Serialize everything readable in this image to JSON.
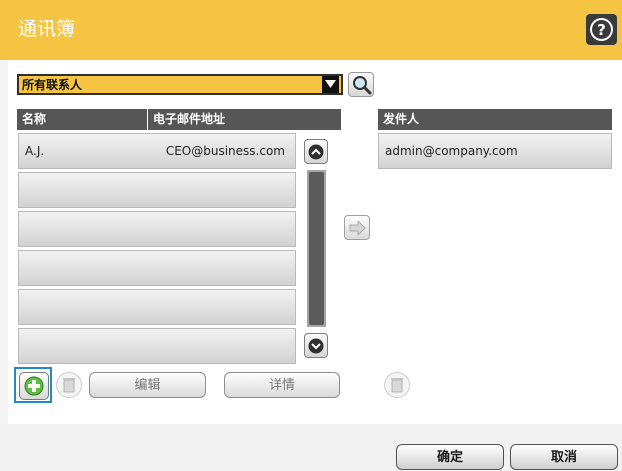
{
  "app": {
    "title": "通讯簿"
  },
  "icons": {
    "help": "help-icon",
    "search": "search-icon",
    "transfer": "arrow-right-icon",
    "add": "add-icon",
    "delete": "trash-icon",
    "scroll_up": "chevron-up-icon",
    "scroll_down": "chevron-down-icon",
    "dropdown": "dropdown-arrow-icon"
  },
  "colors": {
    "header": "#f6c443",
    "selected_outline": "#1e8ac9"
  },
  "filter": {
    "selected": "所有联系人"
  },
  "contacts": {
    "columns": {
      "name": "名称",
      "email": "电子邮件地址"
    },
    "rows": [
      {
        "name": "A.J.",
        "email": "CEO@business.com"
      },
      {
        "name": "",
        "email": ""
      },
      {
        "name": "",
        "email": ""
      },
      {
        "name": "",
        "email": ""
      },
      {
        "name": "",
        "email": ""
      },
      {
        "name": "",
        "email": ""
      }
    ]
  },
  "sender": {
    "column": "发件人",
    "rows": [
      {
        "email": "admin@company.com"
      }
    ]
  },
  "actions": {
    "edit": "编辑",
    "details": "详情"
  },
  "footer": {
    "ok": "确定",
    "cancel": "取消"
  }
}
